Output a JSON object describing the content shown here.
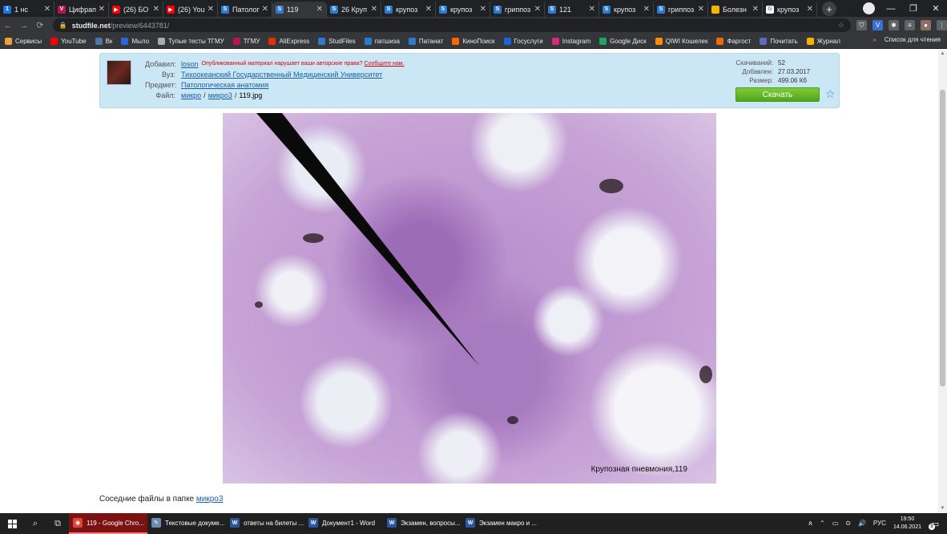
{
  "tabs": [
    {
      "label": "1 нс",
      "color": "#1a73e8",
      "glyph": "1"
    },
    {
      "label": "Цифрап",
      "color": "#b4194a",
      "glyph": "V"
    },
    {
      "label": "(26) БО",
      "color": "#ff0000",
      "glyph": "▶"
    },
    {
      "label": "(26) You",
      "color": "#ff0000",
      "glyph": "▶"
    },
    {
      "label": "Патолог",
      "color": "#2d7bd1",
      "glyph": "S"
    },
    {
      "label": "119",
      "color": "#2d7bd1",
      "glyph": "S"
    },
    {
      "label": "26 Круп",
      "color": "#2d7bd1",
      "glyph": "S"
    },
    {
      "label": "крупоз",
      "color": "#2d7bd1",
      "glyph": "S"
    },
    {
      "label": "крупоз",
      "color": "#2d7bd1",
      "glyph": "S"
    },
    {
      "label": "гриппоз",
      "color": "#2d7bd1",
      "glyph": "S"
    },
    {
      "label": "121",
      "color": "#2d7bd1",
      "glyph": "S"
    },
    {
      "label": "крупоз",
      "color": "#2d7bd1",
      "glyph": "S"
    },
    {
      "label": "гриппоз",
      "color": "#2d7bd1",
      "glyph": "S"
    },
    {
      "label": "Болезн",
      "color": "#f4b400",
      "glyph": ""
    },
    {
      "label": "крупоз",
      "color": "#ffffff",
      "glyph": "G"
    }
  ],
  "tab_close": "✕",
  "new_tab": "+",
  "window_controls": {
    "minimize": "—",
    "maximize": "❐",
    "close": "✕"
  },
  "address": {
    "host": "studfile.net",
    "path": "/preview/6443781/",
    "lock": "🔒",
    "star": "☆"
  },
  "nav": {
    "back": "←",
    "forward": "→",
    "reload": "⟳"
  },
  "extensions": [
    {
      "name": "shield-extension-icon",
      "color": "#5f6368",
      "glyph": "⛉"
    },
    {
      "name": "v-extension-icon",
      "color": "#3b6fd6",
      "glyph": "V"
    },
    {
      "name": "puzzle-extension-icon",
      "color": "#5f6368",
      "glyph": "✱"
    },
    {
      "name": "reading-list-icon",
      "color": "#5f6368",
      "glyph": "≡"
    },
    {
      "name": "profile-avatar-icon",
      "color": "#8d6e63",
      "glyph": "●"
    },
    {
      "name": "menu-dots-icon",
      "color": "#5f6368",
      "glyph": "⋮"
    }
  ],
  "bookmarks": [
    {
      "label": "Сервисы",
      "color": "#e8a23c"
    },
    {
      "label": "YouTube",
      "color": "#ff0000"
    },
    {
      "label": "Вк",
      "color": "#4a76a8"
    },
    {
      "label": "Мыло",
      "color": "#2d69d6"
    },
    {
      "label": "Тупые тесты ТГМУ",
      "color": "#aaaaaa"
    },
    {
      "label": "ТГМУ",
      "color": "#b4194a"
    },
    {
      "label": "AliExpress",
      "color": "#e62e04"
    },
    {
      "label": "StudFiles",
      "color": "#2d7bd1"
    },
    {
      "label": "патшиза",
      "color": "#2d7bd1"
    },
    {
      "label": "Патанат",
      "color": "#2d7bd1"
    },
    {
      "label": "КиноПоиск",
      "color": "#ff6600"
    },
    {
      "label": "Госуслуги",
      "color": "#1c64d8"
    },
    {
      "label": "Instagram",
      "color": "#d62976"
    },
    {
      "label": "Google Диск",
      "color": "#1fa463"
    },
    {
      "label": "QIWI Кошелек",
      "color": "#ff8c00"
    },
    {
      "label": "Фаргост",
      "color": "#ef6c00"
    },
    {
      "label": "Почитать",
      "color": "#5c6bc0"
    },
    {
      "label": "Журнал",
      "color": "#f4b400"
    }
  ],
  "bookmarks_more": "»",
  "reading_list": "Список для чтения",
  "file": {
    "added_label": "Добавил:",
    "author": "loson",
    "warning": "Опубликованный материал нарушает ваши авторские права?",
    "report_link": "Сообщите нам.",
    "uni_label": "Вуз:",
    "university": "Тихоокеанский Государственный Медицинский Университет",
    "subject_label": "Предмет:",
    "subject": "Патологическая анатомия",
    "file_label": "Файл:",
    "crumb1": "микро",
    "crumb2": "микро3",
    "filename": "119.jpg",
    "separator": "/"
  },
  "stats": [
    {
      "key": "Скачиваний:",
      "value": "52"
    },
    {
      "key": "Добавлен:",
      "value": "27.03.2017"
    },
    {
      "key": "Размер:",
      "value": "499.06 Кб"
    }
  ],
  "download_label": "Скачать",
  "favorite_star": "☆",
  "image_caption": "Крупозная пневмония,119",
  "neighbors": {
    "text": "Соседние файлы в папке",
    "link": "микро3"
  },
  "taskbar": {
    "search": "⌕",
    "taskview": "⧉",
    "apps": [
      {
        "label": "119 - Google Chro...",
        "color": "#db4437",
        "glyph": "◉",
        "active": true
      },
      {
        "label": "Текстовые докуме...",
        "color": "#6a8caf",
        "glyph": "✎",
        "active": false
      },
      {
        "label": "ответы на билеты ...",
        "color": "#2b579a",
        "glyph": "W",
        "active": false
      },
      {
        "label": "Документ1 - Word",
        "color": "#2b579a",
        "glyph": "W",
        "active": false
      },
      {
        "label": "Экзамен, вопросы...",
        "color": "#2b579a",
        "glyph": "W",
        "active": false
      },
      {
        "label": "Экзамен макро и ...",
        "color": "#2b579a",
        "glyph": "W",
        "active": false
      }
    ],
    "tray": [
      "ጰ",
      "⌃",
      "▭",
      "⊙",
      "🔊",
      "РУС"
    ],
    "time": "19:50",
    "date": "14.06.2021",
    "notif_count": "8"
  }
}
